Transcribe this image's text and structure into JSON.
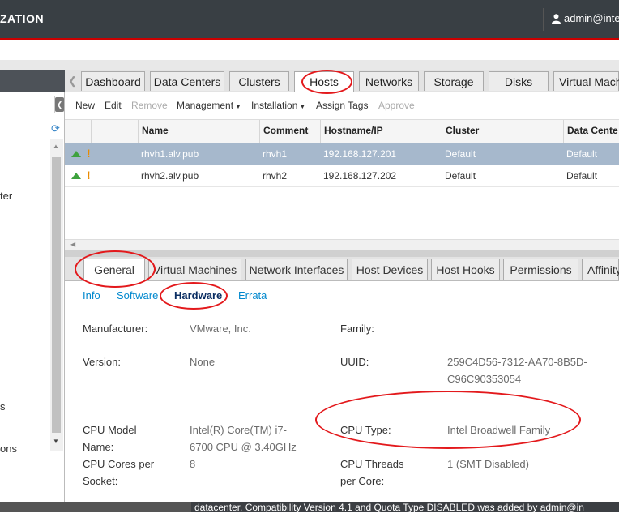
{
  "header": {
    "brand": "ZATION",
    "user": "admin@inte"
  },
  "main_tabs": [
    {
      "label": "Dashboard"
    },
    {
      "label": "Data Centers"
    },
    {
      "label": "Clusters"
    },
    {
      "label": "Hosts"
    },
    {
      "label": "Networks"
    },
    {
      "label": "Storage"
    },
    {
      "label": "Disks"
    },
    {
      "label": "Virtual Mach"
    }
  ],
  "toolbar": {
    "new": "New",
    "edit": "Edit",
    "remove": "Remove",
    "management": "Management",
    "installation": "Installation",
    "assign_tags": "Assign Tags",
    "approve": "Approve"
  },
  "left_panel": {
    "items": [
      "ter",
      "s",
      "ons"
    ]
  },
  "grid": {
    "columns": [
      "Name",
      "Comment",
      "Hostname/IP",
      "Cluster",
      "Data Cente"
    ],
    "rows": [
      {
        "name": "rhvh1.alv.pub",
        "comment": "rhvh1",
        "hostname": "192.168.127.201",
        "cluster": "Default",
        "datacenter": "Default"
      },
      {
        "name": "rhvh2.alv.pub",
        "comment": "rhvh2",
        "hostname": "192.168.127.202",
        "cluster": "Default",
        "datacenter": "Default"
      }
    ]
  },
  "sub_tabs": [
    {
      "label": "General"
    },
    {
      "label": "Virtual Machines"
    },
    {
      "label": "Network Interfaces"
    },
    {
      "label": "Host Devices"
    },
    {
      "label": "Host Hooks"
    },
    {
      "label": "Permissions"
    },
    {
      "label": "Affinity"
    }
  ],
  "general_tabs": [
    {
      "label": "Info"
    },
    {
      "label": "Software"
    },
    {
      "label": "Hardware"
    },
    {
      "label": "Errata"
    }
  ],
  "hardware": {
    "manufacturer_label": "Manufacturer:",
    "manufacturer_value": "VMware, Inc.",
    "family_label": "Family:",
    "family_value": "",
    "version_label": "Version:",
    "version_value": "None",
    "uuid_label": "UUID:",
    "uuid_value_1": "259C4D56-7312-AA70-8B5D-",
    "uuid_value_2": "C96C90353054",
    "cpu_model_label_1": "CPU Model",
    "cpu_model_label_2": "Name:",
    "cpu_model_value_1": "Intel(R) Core(TM) i7-",
    "cpu_model_value_2": "6700 CPU @ 3.40GHz",
    "cpu_type_label": "CPU Type:",
    "cpu_type_value": "Intel Broadwell Family",
    "cpu_cores_label_1": "CPU Cores per",
    "cpu_cores_label_2": "Socket:",
    "cpu_cores_value": "8",
    "cpu_threads_label_1": "CPU Threads",
    "cpu_threads_label_2": "per Core:",
    "cpu_threads_value": "1 (SMT Disabled)"
  },
  "status_bar": {
    "message": "datacenter. Compatibility Version 4.1 and Quota Type DISABLED was added by admin@in"
  },
  "colors": {
    "topbar": "#393f44",
    "selected_row": "#a6b8cc",
    "link": "#0088ce",
    "annotation": "#e3191c"
  }
}
